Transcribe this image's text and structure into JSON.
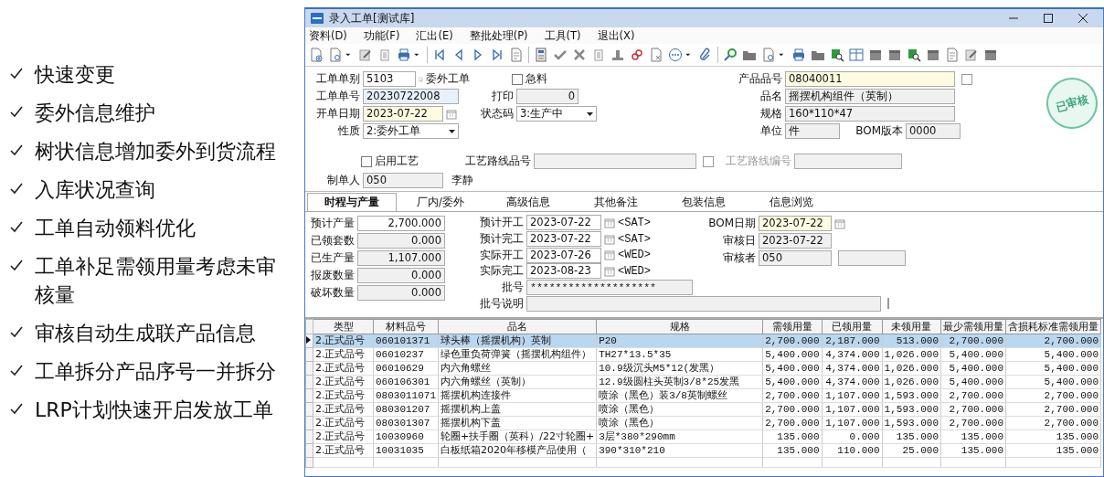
{
  "features": [
    "快速变更",
    "委外信息维护",
    "树状信息增加委外到货流程",
    "入库状况查询",
    "工单自动领料优化",
    "工单补足需领用量考虑未审核量",
    "审核自动生成联产品信息",
    "工单拆分产品序号一并拆分",
    "LRP计划快速开启发放工单"
  ],
  "window": {
    "title": "录入工单[测试库]"
  },
  "menu": [
    "资料(D)",
    "功能(F)",
    "汇出(E)",
    "整批处理(P)",
    "工具(T)",
    "退出(X)"
  ],
  "header": {
    "order_type": {
      "label": "工单单别",
      "value": "5103",
      "readonly": false,
      "type_name": "委外工单"
    },
    "urgent": {
      "label": "急料",
      "checked": false
    },
    "product_no": {
      "label": "产品品号",
      "value": "08040011",
      "required": true
    },
    "order_no": {
      "label": "工单单号",
      "value": "20230722008",
      "focused": true
    },
    "print": {
      "label": "打印",
      "value": "0",
      "readonly": true
    },
    "product_name": {
      "label": "品名",
      "value": "摇摆机构组件（英制）",
      "readonly": true
    },
    "open_date": {
      "label": "开单日期",
      "value": "2023-07-22",
      "required": true
    },
    "status_code": {
      "label": "状态码",
      "value": "3:生产中",
      "readonly": false
    },
    "spec": {
      "label": "规格",
      "value": "160*110*47",
      "readonly": true
    },
    "nature": {
      "label": "性质",
      "value": "2:委外工单",
      "readonly": false
    },
    "unit": {
      "label": "单位",
      "value": "件",
      "readonly": true
    },
    "bom_version": {
      "label": "BOM版本",
      "value": "0000",
      "readonly": true
    },
    "use_route": {
      "label": "启用工艺",
      "checked": false
    },
    "route_product": {
      "label": "工艺路线品号",
      "readonly": true
    },
    "route_no": {
      "label": "工艺路线编号",
      "disabled": true
    },
    "creator": {
      "label": "制单人",
      "value": "050",
      "readonly": true,
      "name": "李静"
    },
    "stamp": "已审核"
  },
  "tabs": [
    {
      "label": "时程与产量",
      "selected": true
    },
    {
      "label": "厂内/委外",
      "selected": false
    },
    {
      "label": "高级信息",
      "selected": false
    },
    {
      "label": "其他备注",
      "selected": false
    },
    {
      "label": "包装信息",
      "selected": false
    },
    {
      "label": "信息浏览",
      "selected": false
    }
  ],
  "quantities": [
    {
      "label": "预计产量",
      "value": "2,700.000",
      "readonly": false
    },
    {
      "label": "已领套数",
      "value": "0.000",
      "readonly": true
    },
    {
      "label": "已生产量",
      "value": "1,107.000",
      "readonly": true
    },
    {
      "label": "报废数量",
      "value": "0.000",
      "readonly": true
    },
    {
      "label": "破坏数量",
      "value": "0.000",
      "readonly": true
    }
  ],
  "dates": [
    {
      "label": "预计开工",
      "value": "2023-07-22",
      "weekday": "<SAT>"
    },
    {
      "label": "预计完工",
      "value": "2023-07-22",
      "weekday": "<SAT>"
    },
    {
      "label": "实际开工",
      "value": "2023-07-26",
      "weekday": "<WED>"
    },
    {
      "label": "实际完工",
      "value": "2023-08-23",
      "weekday": "<WED>"
    }
  ],
  "batch": {
    "label": "批号",
    "value": "********************"
  },
  "batch_desc": {
    "label": "批号说明"
  },
  "review": [
    {
      "label": "BOM日期",
      "value": "2023-07-22",
      "required": true
    },
    {
      "label": "审核日",
      "value": "2023-07-22",
      "readonly": true
    },
    {
      "label": "审核者",
      "value": "050",
      "readonly": true
    }
  ],
  "table": {
    "columns": [
      "类型",
      "材料品号",
      "品名",
      "规格",
      "需领用量",
      "已领用量",
      "未领用量",
      "最少需领用量",
      "含损耗标准需领用量"
    ],
    "rows": [
      {
        "selected": true,
        "cells": [
          "2.正式品号",
          "060101371",
          "球头棒（摇摆机构）英制",
          "P20",
          "2,700.000",
          "2,187.000",
          "513.000",
          "2,700.000",
          "2,700.000"
        ]
      },
      {
        "selected": false,
        "cells": [
          "2.正式品号",
          "06010237",
          "绿色重负荷弹簧（摇摆机构组件）",
          "TH27*13.5*35",
          "5,400.000",
          "4,374.000",
          "1,026.000",
          "5,400.000",
          "5,400.000"
        ]
      },
      {
        "selected": false,
        "cells": [
          "2.正式品号",
          "06010629",
          "内六角螺丝",
          "10.9级沉头M5*12(发黑）",
          "5,400.000",
          "4,374.000",
          "1,026.000",
          "5,400.000",
          "5,400.000"
        ]
      },
      {
        "selected": false,
        "cells": [
          "2.正式品号",
          "060106301",
          "内六角螺丝（英制）",
          "12.9级圆柱头英制3/8*25发黑",
          "5,400.000",
          "4,374.000",
          "1,026.000",
          "5,400.000",
          "5,400.000"
        ]
      },
      {
        "selected": false,
        "cells": [
          "2.正式品号",
          "0803011071",
          "摇摆机构连接件",
          "喷涂（黑色）装3/8英制螺丝",
          "2,700.000",
          "1,107.000",
          "1,593.000",
          "2,700.000",
          "2,700.000"
        ]
      },
      {
        "selected": false,
        "cells": [
          "2.正式品号",
          "080301207",
          "摇摆机构上盖",
          "喷涂（黑色）",
          "2,700.000",
          "1,107.000",
          "1,593.000",
          "2,700.000",
          "2,700.000"
        ]
      },
      {
        "selected": false,
        "cells": [
          "2.正式品号",
          "080301307",
          "摇摆机构下盖",
          "喷涂（黑色）",
          "2,700.000",
          "1,107.000",
          "1,593.000",
          "2,700.000",
          "2,700.000"
        ]
      },
      {
        "selected": false,
        "cells": [
          "2.正式品号",
          "10030960",
          "轮圈+扶手圈（英科）/22寸轮圈+",
          "3层*380*290mm",
          "135.000",
          "0.000",
          "135.000",
          "135.000",
          "135.000"
        ]
      },
      {
        "selected": false,
        "cells": [
          "2.正式品号",
          "10031035",
          "白板纸箱2020年移模产品使用（",
          "390*310*210",
          "135.000",
          "110.000",
          "25.000",
          "135.000",
          "135.000"
        ]
      }
    ]
  }
}
